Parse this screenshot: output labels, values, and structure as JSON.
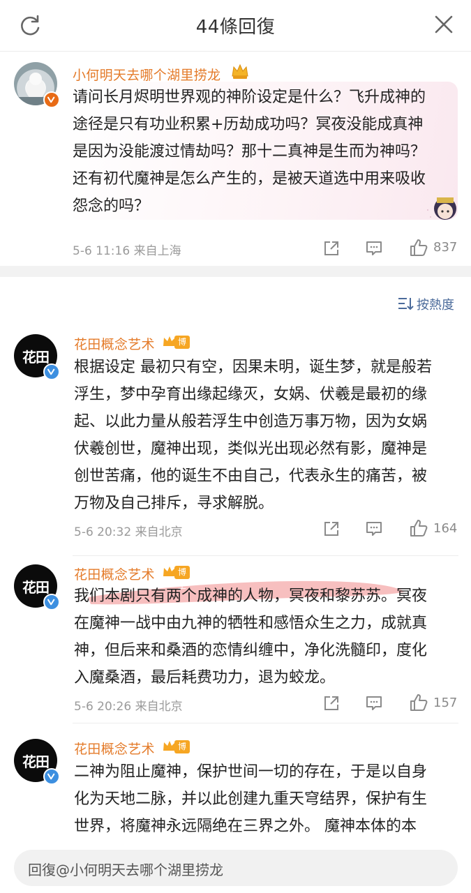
{
  "header": {
    "title": "44條回復"
  },
  "original_post": {
    "username": "小何明天去哪个湖里捞龙",
    "text_lines": [
      "请问长月烬明世界观的神阶设定是什么？飞升成神的",
      "途径是只有功业积累+历劫成功吗？冥夜没能成真神",
      "是因为没能渡过情劫吗？那十二真神是生而为神吗？",
      "还有初代魔神是怎么产生的，是被天道选中用来吸收",
      "怨念的吗？"
    ],
    "time_location": "5-6 11:16  来自上海",
    "likes": "837"
  },
  "sort": {
    "label": "按熱度"
  },
  "replies": [
    {
      "username": "花田概念艺术",
      "role_tag": "博主",
      "text_lines": [
        "根据设定 最初只有空，因果未明，诞生梦，就是般若",
        "浮生，梦中孕育出缘起缘灭，女娲、伏羲是最初的缘",
        "起、以此力量从般若浮生中创造万事万物，因为女娲",
        "伏羲创世，魔神出现，类似光出现必然有影，魔神是",
        "创世苦痛，他的诞生不由自己，代表永生的痛苦，被",
        "万物及自己排斥，寻求解脱。"
      ],
      "time_location": "5-6 20:32  来自北京",
      "likes": "164"
    },
    {
      "username": "花田概念艺术",
      "role_tag": "博主",
      "text_lines": [
        "我们本剧只有两个成神的人物，冥夜和黎苏苏。冥夜",
        "在魔神一战中由九神的牺牲和感悟众生之力，成就真",
        "神，但后来和桑酒的恋情纠缠中，净化洗髓印，度化",
        "入魔桑酒，最后耗费功力，退为蛟龙。"
      ],
      "time_location": "5-6 20:26  来自北京",
      "likes": "157"
    },
    {
      "username": "花田概念艺术",
      "role_tag": "博主",
      "text_lines": [
        "二神为阻止魔神，保护世间一切的存在，于是以自身",
        "化为天地二脉，并以此创建九重天穹结界，保护有生",
        "世界，将魔神永远隔绝在三界之外。 魔神本体的本"
      ]
    }
  ],
  "avatar_logo_text": "花田",
  "reply_input": {
    "placeholder": "回復@小何明天去哪个湖里捞龙"
  },
  "colors": {
    "username": "#e47b2a",
    "highlight": "#f08a8a",
    "bozhu_tag": "#f6a623",
    "verified": "#3d8fe0",
    "orange_v": "#e86b16"
  }
}
